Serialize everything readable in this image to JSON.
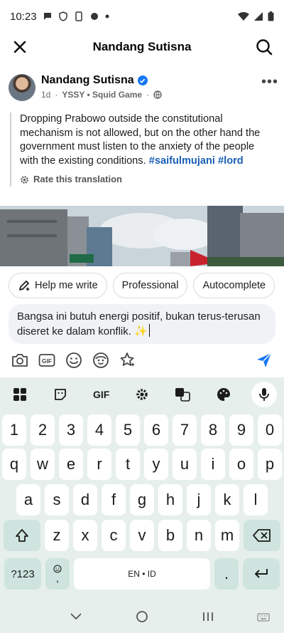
{
  "status_bar": {
    "time": "10:23",
    "icons": [
      "chat-icon",
      "shield-v-icon",
      "phone-clip-icon",
      "game-controller-icon",
      "dot-icon"
    ],
    "right_icons": [
      "wifi-icon",
      "signal-icon",
      "battery-icon"
    ]
  },
  "header": {
    "title": "Nandang Sutisna",
    "close_icon": "close-icon",
    "search_icon": "search-icon"
  },
  "post": {
    "author": "Nandang Sutisna",
    "time": "1d",
    "dot": "·",
    "group": "YSSY • Squid Game",
    "dot2": "·",
    "privacy_icon": "globe-icon",
    "more_label": "•••",
    "text": "Dropping Prabowo outside the constitutional mechanism is not allowed, but on the other hand the government must listen to the anxiety of the people with the existing conditions. ",
    "hashtags": [
      "#saifulmujani",
      "#lord"
    ],
    "rate_label": "Rate this translation"
  },
  "chips": [
    {
      "label": "Help me write",
      "icon": "pencil-sparkle-icon"
    },
    {
      "label": "Professional"
    },
    {
      "label": "Autocomplete"
    }
  ],
  "compose": {
    "value": "Bangsa ini butuh energi positif, bukan terus-terusan diseret ke dalam konflik. ✨"
  },
  "toolbar": {
    "icons": [
      "camera-icon",
      "gif-icon",
      "emoji-icon",
      "avatar-sticker-icon",
      "sparkle-star-icon"
    ],
    "send_icon": "send-icon"
  },
  "keyboard": {
    "top": {
      "gif": "GIF"
    },
    "row_numbers": [
      "1",
      "2",
      "3",
      "4",
      "5",
      "6",
      "7",
      "8",
      "9",
      "0"
    ],
    "row1": [
      "q",
      "w",
      "e",
      "r",
      "t",
      "y",
      "u",
      "i",
      "o",
      "p"
    ],
    "row2": [
      "a",
      "s",
      "d",
      "f",
      "g",
      "h",
      "j",
      "k",
      "l"
    ],
    "row3": [
      "z",
      "x",
      "c",
      "v",
      "b",
      "n",
      "m"
    ],
    "sym": "?123",
    "comma": ",",
    "space": "EN • ID",
    "period": "."
  }
}
